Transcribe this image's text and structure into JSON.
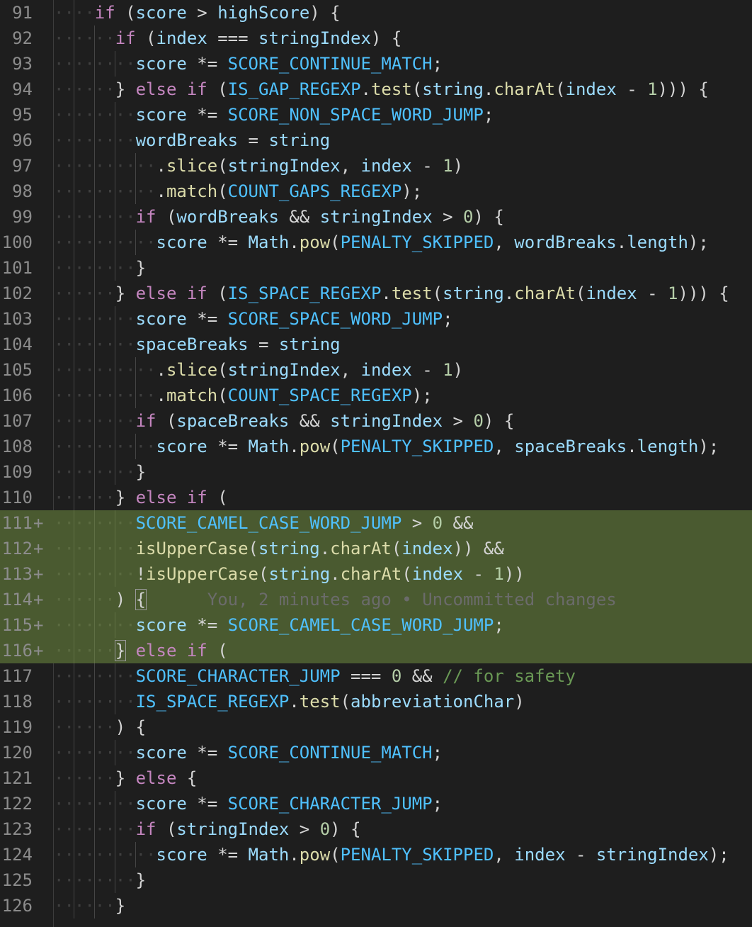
{
  "editor": {
    "colors": {
      "background": "#1e1e1e",
      "added_line": "#4a5a30",
      "keyword": "#c586c0",
      "variable": "#9cdcfe",
      "constant": "#4fc1ff",
      "function": "#dcdcaa",
      "number": "#b5cea8",
      "comment": "#6a9955"
    },
    "blame": "You, 2 minutes ago • Uncommitted changes",
    "lines": [
      {
        "n": "91",
        "indent": 2,
        "added": false,
        "tokens": [
          [
            "kw",
            "if"
          ],
          [
            "p",
            " ("
          ],
          [
            "v",
            "score"
          ],
          [
            "op",
            " > "
          ],
          [
            "v",
            "highScore"
          ],
          [
            "p",
            ") {"
          ]
        ]
      },
      {
        "n": "92",
        "indent": 3,
        "added": false,
        "tokens": [
          [
            "kw",
            "if"
          ],
          [
            "p",
            " ("
          ],
          [
            "v",
            "index"
          ],
          [
            "op",
            " === "
          ],
          [
            "v",
            "stringIndex"
          ],
          [
            "p",
            ") {"
          ]
        ]
      },
      {
        "n": "93",
        "indent": 4,
        "added": false,
        "tokens": [
          [
            "v",
            "score"
          ],
          [
            "op",
            " *= "
          ],
          [
            "c",
            "SCORE_CONTINUE_MATCH"
          ],
          [
            "p",
            ";"
          ]
        ]
      },
      {
        "n": "94",
        "indent": 3,
        "added": false,
        "tokens": [
          [
            "p",
            "} "
          ],
          [
            "kw",
            "else"
          ],
          [
            "p",
            " "
          ],
          [
            "kw",
            "if"
          ],
          [
            "p",
            " ("
          ],
          [
            "c",
            "IS_GAP_REGEXP"
          ],
          [
            "p",
            "."
          ],
          [
            "fn",
            "test"
          ],
          [
            "p",
            "("
          ],
          [
            "v",
            "string"
          ],
          [
            "p",
            "."
          ],
          [
            "fn",
            "charAt"
          ],
          [
            "p",
            "("
          ],
          [
            "v",
            "index"
          ],
          [
            "op",
            " - "
          ],
          [
            "num",
            "1"
          ],
          [
            "p",
            "))) {"
          ]
        ]
      },
      {
        "n": "95",
        "indent": 4,
        "added": false,
        "tokens": [
          [
            "v",
            "score"
          ],
          [
            "op",
            " *= "
          ],
          [
            "c",
            "SCORE_NON_SPACE_WORD_JUMP"
          ],
          [
            "p",
            ";"
          ]
        ]
      },
      {
        "n": "96",
        "indent": 4,
        "added": false,
        "tokens": [
          [
            "v",
            "wordBreaks"
          ],
          [
            "op",
            " = "
          ],
          [
            "v",
            "string"
          ]
        ]
      },
      {
        "n": "97",
        "indent": 5,
        "added": false,
        "tokens": [
          [
            "p",
            "."
          ],
          [
            "fn",
            "slice"
          ],
          [
            "p",
            "("
          ],
          [
            "v",
            "stringIndex"
          ],
          [
            "p",
            ", "
          ],
          [
            "v",
            "index"
          ],
          [
            "op",
            " - "
          ],
          [
            "num",
            "1"
          ],
          [
            "p",
            ")"
          ]
        ]
      },
      {
        "n": "98",
        "indent": 5,
        "added": false,
        "tokens": [
          [
            "p",
            "."
          ],
          [
            "fn",
            "match"
          ],
          [
            "p",
            "("
          ],
          [
            "c",
            "COUNT_GAPS_REGEXP"
          ],
          [
            "p",
            ");"
          ]
        ]
      },
      {
        "n": "99",
        "indent": 4,
        "added": false,
        "tokens": [
          [
            "kw",
            "if"
          ],
          [
            "p",
            " ("
          ],
          [
            "v",
            "wordBreaks"
          ],
          [
            "op",
            " && "
          ],
          [
            "v",
            "stringIndex"
          ],
          [
            "op",
            " > "
          ],
          [
            "num",
            "0"
          ],
          [
            "p",
            ") {"
          ]
        ]
      },
      {
        "n": "100",
        "indent": 5,
        "added": false,
        "tokens": [
          [
            "v",
            "score"
          ],
          [
            "op",
            " *= "
          ],
          [
            "v",
            "Math"
          ],
          [
            "p",
            "."
          ],
          [
            "fn",
            "pow"
          ],
          [
            "p",
            "("
          ],
          [
            "c",
            "PENALTY_SKIPPED"
          ],
          [
            "p",
            ", "
          ],
          [
            "v",
            "wordBreaks"
          ],
          [
            "p",
            "."
          ],
          [
            "v",
            "length"
          ],
          [
            "p",
            ");"
          ]
        ]
      },
      {
        "n": "101",
        "indent": 4,
        "added": false,
        "tokens": [
          [
            "p",
            "}"
          ]
        ]
      },
      {
        "n": "102",
        "indent": 3,
        "added": false,
        "tokens": [
          [
            "p",
            "} "
          ],
          [
            "kw",
            "else"
          ],
          [
            "p",
            " "
          ],
          [
            "kw",
            "if"
          ],
          [
            "p",
            " ("
          ],
          [
            "c",
            "IS_SPACE_REGEXP"
          ],
          [
            "p",
            "."
          ],
          [
            "fn",
            "test"
          ],
          [
            "p",
            "("
          ],
          [
            "v",
            "string"
          ],
          [
            "p",
            "."
          ],
          [
            "fn",
            "charAt"
          ],
          [
            "p",
            "("
          ],
          [
            "v",
            "index"
          ],
          [
            "op",
            " - "
          ],
          [
            "num",
            "1"
          ],
          [
            "p",
            "))) {"
          ]
        ]
      },
      {
        "n": "103",
        "indent": 4,
        "added": false,
        "tokens": [
          [
            "v",
            "score"
          ],
          [
            "op",
            " *= "
          ],
          [
            "c",
            "SCORE_SPACE_WORD_JUMP"
          ],
          [
            "p",
            ";"
          ]
        ]
      },
      {
        "n": "104",
        "indent": 4,
        "added": false,
        "tokens": [
          [
            "v",
            "spaceBreaks"
          ],
          [
            "op",
            " = "
          ],
          [
            "v",
            "string"
          ]
        ]
      },
      {
        "n": "105",
        "indent": 5,
        "added": false,
        "tokens": [
          [
            "p",
            "."
          ],
          [
            "fn",
            "slice"
          ],
          [
            "p",
            "("
          ],
          [
            "v",
            "stringIndex"
          ],
          [
            "p",
            ", "
          ],
          [
            "v",
            "index"
          ],
          [
            "op",
            " - "
          ],
          [
            "num",
            "1"
          ],
          [
            "p",
            ")"
          ]
        ]
      },
      {
        "n": "106",
        "indent": 5,
        "added": false,
        "tokens": [
          [
            "p",
            "."
          ],
          [
            "fn",
            "match"
          ],
          [
            "p",
            "("
          ],
          [
            "c",
            "COUNT_SPACE_REGEXP"
          ],
          [
            "p",
            ");"
          ]
        ]
      },
      {
        "n": "107",
        "indent": 4,
        "added": false,
        "tokens": [
          [
            "kw",
            "if"
          ],
          [
            "p",
            " ("
          ],
          [
            "v",
            "spaceBreaks"
          ],
          [
            "op",
            " && "
          ],
          [
            "v",
            "stringIndex"
          ],
          [
            "op",
            " > "
          ],
          [
            "num",
            "0"
          ],
          [
            "p",
            ") {"
          ]
        ]
      },
      {
        "n": "108",
        "indent": 5,
        "added": false,
        "tokens": [
          [
            "v",
            "score"
          ],
          [
            "op",
            " *= "
          ],
          [
            "v",
            "Math"
          ],
          [
            "p",
            "."
          ],
          [
            "fn",
            "pow"
          ],
          [
            "p",
            "("
          ],
          [
            "c",
            "PENALTY_SKIPPED"
          ],
          [
            "p",
            ", "
          ],
          [
            "v",
            "spaceBreaks"
          ],
          [
            "p",
            "."
          ],
          [
            "v",
            "length"
          ],
          [
            "p",
            ");"
          ]
        ]
      },
      {
        "n": "109",
        "indent": 4,
        "added": false,
        "tokens": [
          [
            "p",
            "}"
          ]
        ]
      },
      {
        "n": "110",
        "indent": 3,
        "added": false,
        "tokens": [
          [
            "p",
            "} "
          ],
          [
            "kw",
            "else"
          ],
          [
            "p",
            " "
          ],
          [
            "kw",
            "if"
          ],
          [
            "p",
            " ("
          ]
        ]
      },
      {
        "n": "111",
        "indent": 4,
        "added": true,
        "tokens": [
          [
            "c",
            "SCORE_CAMEL_CASE_WORD_JUMP"
          ],
          [
            "op",
            " > "
          ],
          [
            "num",
            "0"
          ],
          [
            "op",
            " &&"
          ]
        ]
      },
      {
        "n": "112",
        "indent": 4,
        "added": true,
        "tokens": [
          [
            "fn",
            "isUpperCase"
          ],
          [
            "p",
            "("
          ],
          [
            "v",
            "string"
          ],
          [
            "p",
            "."
          ],
          [
            "fn",
            "charAt"
          ],
          [
            "p",
            "("
          ],
          [
            "v",
            "index"
          ],
          [
            "p",
            "))"
          ],
          [
            "op",
            " &&"
          ]
        ]
      },
      {
        "n": "113",
        "indent": 4,
        "added": true,
        "tokens": [
          [
            "op",
            "!"
          ],
          [
            "fn",
            "isUpperCase"
          ],
          [
            "p",
            "("
          ],
          [
            "v",
            "string"
          ],
          [
            "p",
            "."
          ],
          [
            "fn",
            "charAt"
          ],
          [
            "p",
            "("
          ],
          [
            "v",
            "index"
          ],
          [
            "op",
            " - "
          ],
          [
            "num",
            "1"
          ],
          [
            "p",
            "))"
          ]
        ]
      },
      {
        "n": "114",
        "indent": 3,
        "added": true,
        "blame": true,
        "tokens": [
          [
            "p",
            ") "
          ],
          [
            "box",
            "{"
          ]
        ]
      },
      {
        "n": "115",
        "indent": 4,
        "added": true,
        "tokens": [
          [
            "v",
            "score"
          ],
          [
            "op",
            " *= "
          ],
          [
            "c",
            "SCORE_CAMEL_CASE_WORD_JUMP"
          ],
          [
            "p",
            ";"
          ]
        ]
      },
      {
        "n": "116",
        "indent": 3,
        "added": true,
        "tokens": [
          [
            "box",
            "}"
          ],
          [
            "p",
            " "
          ],
          [
            "kw",
            "else"
          ],
          [
            "p",
            " "
          ],
          [
            "kw",
            "if"
          ],
          [
            "p",
            " ("
          ]
        ]
      },
      {
        "n": "117",
        "indent": 4,
        "added": false,
        "tokens": [
          [
            "c",
            "SCORE_CHARACTER_JUMP"
          ],
          [
            "op",
            " === "
          ],
          [
            "num",
            "0"
          ],
          [
            "op",
            " && "
          ],
          [
            "cm",
            "// for safety"
          ]
        ]
      },
      {
        "n": "118",
        "indent": 4,
        "added": false,
        "tokens": [
          [
            "c",
            "IS_SPACE_REGEXP"
          ],
          [
            "p",
            "."
          ],
          [
            "fn",
            "test"
          ],
          [
            "p",
            "("
          ],
          [
            "v",
            "abbreviationChar"
          ],
          [
            "p",
            ")"
          ]
        ]
      },
      {
        "n": "119",
        "indent": 3,
        "added": false,
        "tokens": [
          [
            "p",
            ") {"
          ]
        ]
      },
      {
        "n": "120",
        "indent": 4,
        "added": false,
        "tokens": [
          [
            "v",
            "score"
          ],
          [
            "op",
            " *= "
          ],
          [
            "c",
            "SCORE_CONTINUE_MATCH"
          ],
          [
            "p",
            ";"
          ]
        ]
      },
      {
        "n": "121",
        "indent": 3,
        "added": false,
        "tokens": [
          [
            "p",
            "} "
          ],
          [
            "kw",
            "else"
          ],
          [
            "p",
            " {"
          ]
        ]
      },
      {
        "n": "122",
        "indent": 4,
        "added": false,
        "tokens": [
          [
            "v",
            "score"
          ],
          [
            "op",
            " *= "
          ],
          [
            "c",
            "SCORE_CHARACTER_JUMP"
          ],
          [
            "p",
            ";"
          ]
        ]
      },
      {
        "n": "123",
        "indent": 4,
        "added": false,
        "tokens": [
          [
            "kw",
            "if"
          ],
          [
            "p",
            " ("
          ],
          [
            "v",
            "stringIndex"
          ],
          [
            "op",
            " > "
          ],
          [
            "num",
            "0"
          ],
          [
            "p",
            ") {"
          ]
        ]
      },
      {
        "n": "124",
        "indent": 5,
        "added": false,
        "tokens": [
          [
            "v",
            "score"
          ],
          [
            "op",
            " *= "
          ],
          [
            "v",
            "Math"
          ],
          [
            "p",
            "."
          ],
          [
            "fn",
            "pow"
          ],
          [
            "p",
            "("
          ],
          [
            "c",
            "PENALTY_SKIPPED"
          ],
          [
            "p",
            ", "
          ],
          [
            "v",
            "index"
          ],
          [
            "op",
            " - "
          ],
          [
            "v",
            "stringIndex"
          ],
          [
            "p",
            ");"
          ]
        ]
      },
      {
        "n": "125",
        "indent": 4,
        "added": false,
        "tokens": [
          [
            "p",
            "}"
          ]
        ]
      },
      {
        "n": "126",
        "indent": 3,
        "added": false,
        "tokens": [
          [
            "p",
            "}"
          ]
        ]
      }
    ]
  }
}
